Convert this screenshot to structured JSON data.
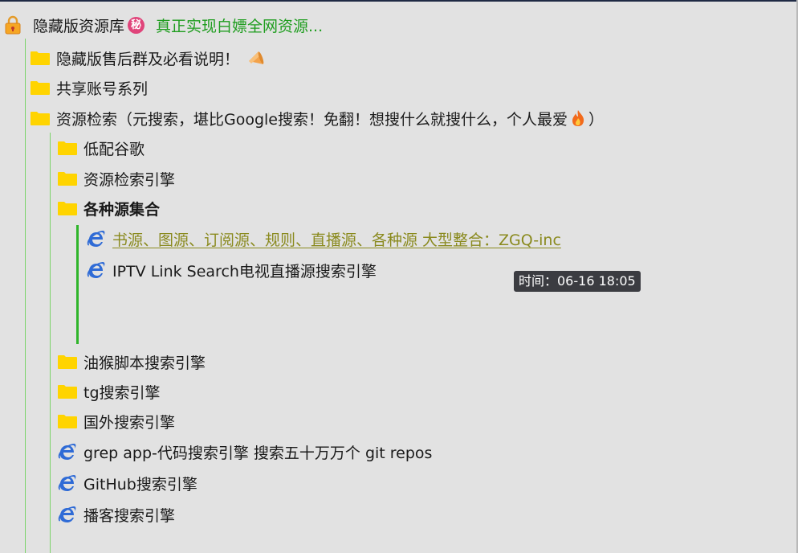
{
  "root": {
    "title": "隐藏版资源库",
    "badge": "秘",
    "subtitle": "真正实现白嫖全网资源..."
  },
  "items": {
    "after_sales": "隐藏版售后群及必看说明！",
    "shared_accounts": "共享账号系列",
    "resource_search": "资源检索（元搜索，堪比Google搜索！免翻！想搜什么就搜什么，个人最爱",
    "resource_search_close": "）",
    "low_google": "低配谷歌",
    "search_engine": "资源检索引擎",
    "sources_collection": "各种源集合",
    "sources_link": "书源、图源、订阅源、规则、直播源、各种源 大型整合：ZGQ-inc",
    "iptv": "IPTV Link Search电视直播源搜索引擎",
    "userscript": "油猴脚本搜索引擎",
    "tg": "tg搜索引擎",
    "foreign": "国外搜索引擎",
    "grep": "grep app-代码搜索引擎 搜索五十万万个 git repos",
    "github": "GitHub搜索引擎",
    "podcast": "播客搜索引擎"
  },
  "tooltip": {
    "text": "时间：06-16 18:05"
  },
  "icons": {
    "lock": "lock-icon",
    "folder": "folder-icon",
    "ie": "ie-browser-icon",
    "horn": "megaphone-icon",
    "fire": "fire-icon"
  },
  "colors": {
    "background": "#e2e2e2",
    "folder": "#ffd400",
    "tree_line": "#7bd36a",
    "green_text": "#1f9d1f",
    "link_text": "#8a8a1e",
    "ie_blue": "#2f6bd6",
    "tooltip_bg": "#3b3c41"
  }
}
